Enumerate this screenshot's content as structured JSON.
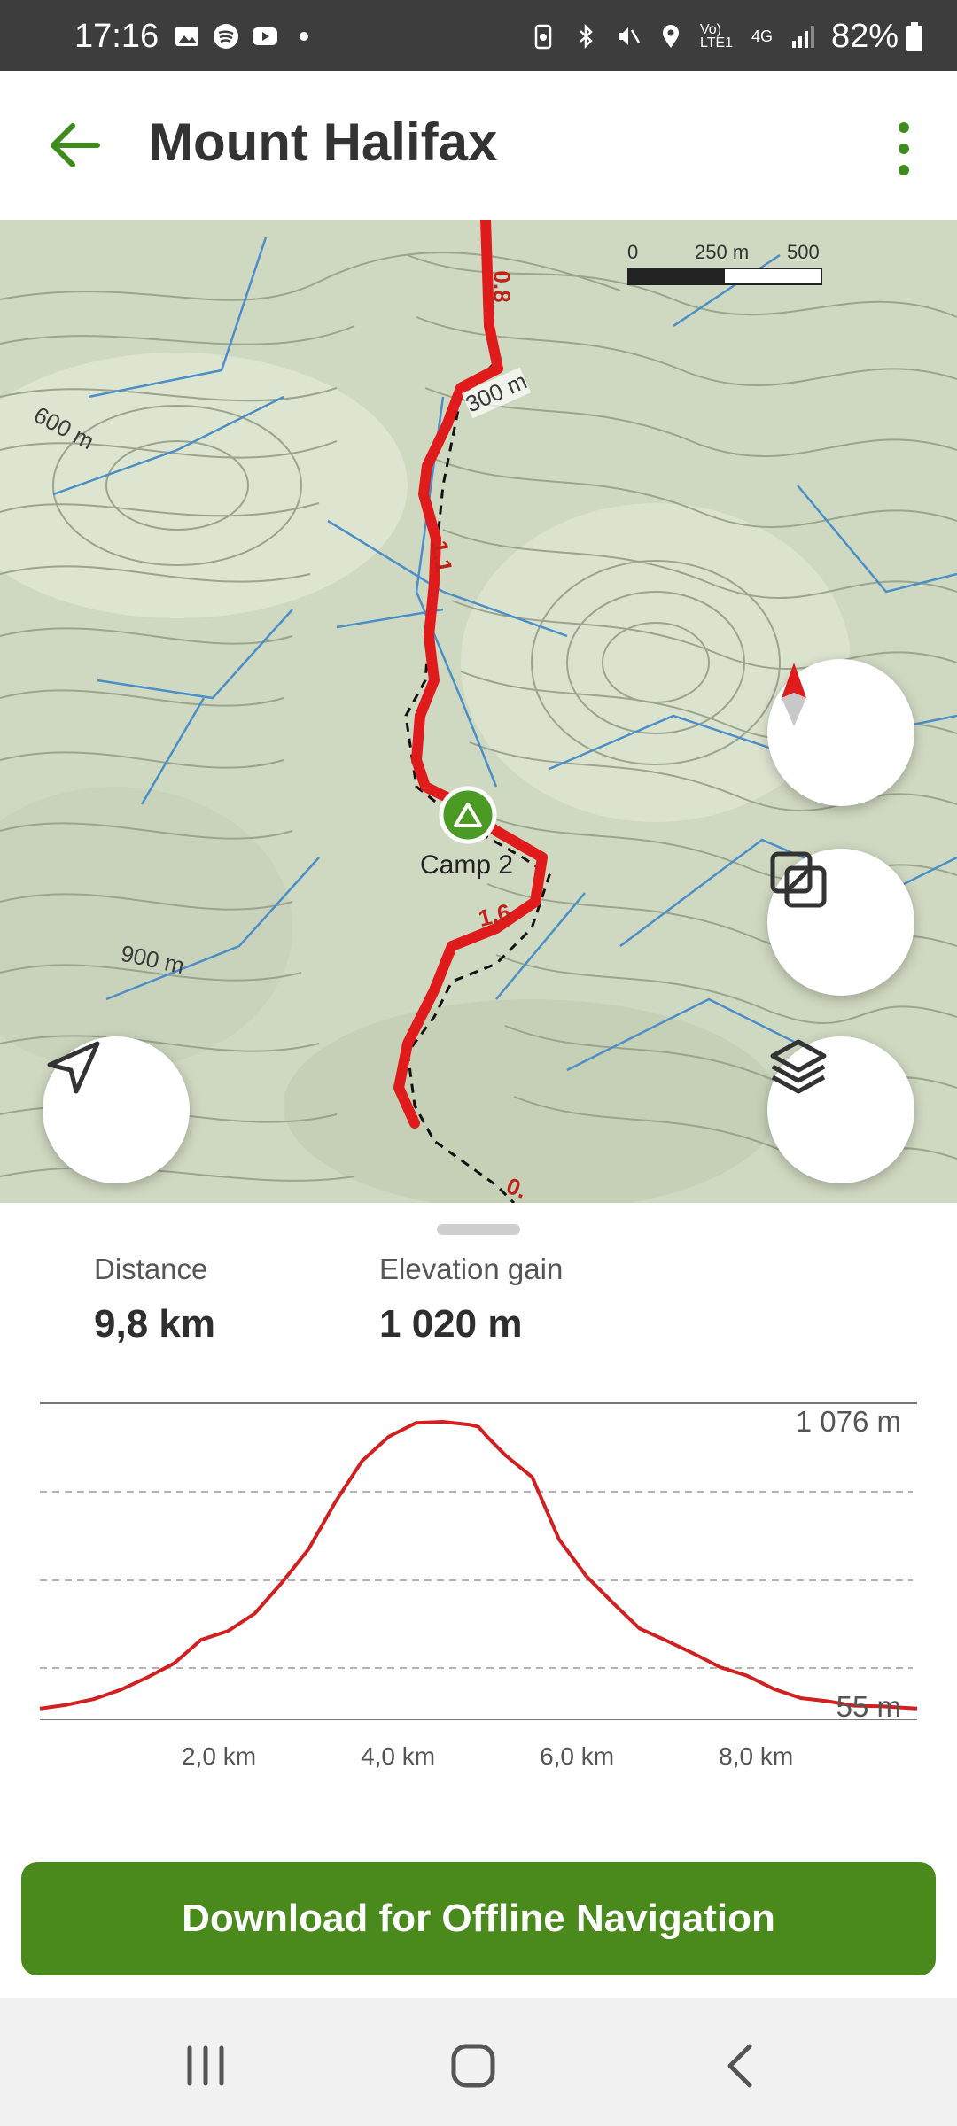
{
  "status_bar": {
    "time": "17:16",
    "battery_text": "82%",
    "network_text": "4G",
    "volte_text": "Vo) LTE1"
  },
  "app_bar": {
    "title": "Mount Halifax",
    "back_icon": "arrow-left-icon",
    "menu_icon": "more-vertical-icon"
  },
  "map": {
    "scale_labels": [
      "0",
      "250 m",
      "500 m"
    ],
    "contour_labels": [
      "600 m",
      "900 m"
    ],
    "trail_labels": [
      "300 m",
      "0.8",
      "1.1",
      "1.6",
      "0."
    ],
    "waypoint_label": "Camp 2",
    "buttons": {
      "compass_icon": "compass-icon",
      "overlay_icon": "overlay-icon",
      "layers_icon": "layers-icon",
      "locate_icon": "navigation-arrow-icon"
    },
    "colors": {
      "trail": "#e01b1b",
      "water": "#4a8fc8",
      "terrain": "#cfd8c1"
    }
  },
  "stats": {
    "distance_label": "Distance",
    "distance_value": "9,8 km",
    "elevation_label": "Elevation gain",
    "elevation_value": "1 020 m"
  },
  "elevation_chart": {
    "type": "area",
    "max_label": "1 076 m",
    "min_label": "55 m",
    "x_ticks": [
      "2,0 km",
      "4,0 km",
      "6,0 km",
      "8,0 km"
    ],
    "x_tick_values": [
      2,
      4,
      6,
      8
    ],
    "xlim": [
      0,
      9.8
    ],
    "ylim": [
      55,
      1076
    ],
    "profile_km": [
      0,
      0.3,
      0.6,
      0.9,
      1.2,
      1.5,
      1.8,
      2.1,
      2.4,
      2.7,
      3.0,
      3.3,
      3.6,
      3.9,
      4.2,
      4.5,
      4.8,
      4.9,
      5.0,
      5.2,
      5.5,
      5.8,
      6.1,
      6.4,
      6.7,
      7.0,
      7.3,
      7.6,
      7.9,
      8.2,
      8.5,
      8.8,
      9.1,
      9.4,
      9.8
    ],
    "profile_elev": [
      62,
      75,
      95,
      128,
      172,
      222,
      305,
      336,
      398,
      506,
      625,
      792,
      938,
      1024,
      1072,
      1076,
      1066,
      1058,
      1022,
      958,
      880,
      660,
      532,
      436,
      345,
      302,
      257,
      208,
      178,
      131,
      99,
      88,
      72,
      70,
      62
    ]
  },
  "download_button": {
    "label": "Download for Offline Navigation"
  },
  "nav_bar": {
    "recent_icon": "recent-apps-icon",
    "home_icon": "home-icon",
    "back_icon": "back-icon"
  }
}
